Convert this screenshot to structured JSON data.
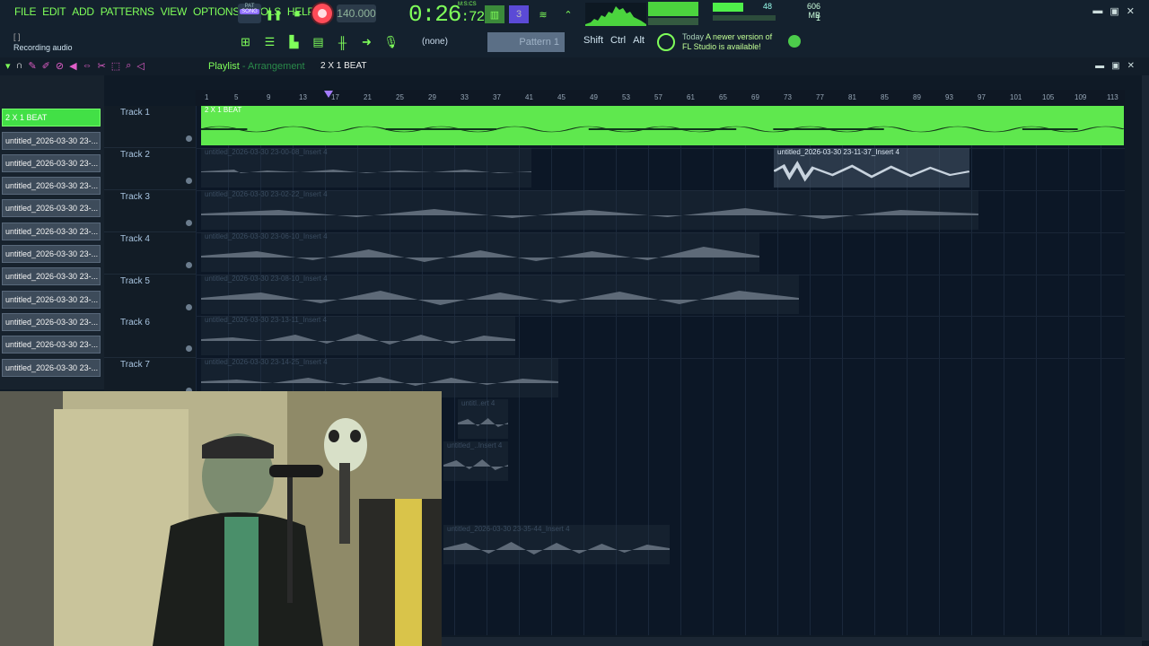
{
  "menu": [
    "FILE",
    "EDIT",
    "ADD",
    "PATTERNS",
    "VIEW",
    "OPTIONS",
    "TOOLS",
    "HELP"
  ],
  "transport": {
    "mode_pat": "PAT",
    "mode_song": "SONG",
    "tempo": "140.000",
    "time": "0:26",
    "time_small": ":72",
    "time_label": "M:S:CS",
    "cpu": "48",
    "memory": "606 MB",
    "voices": "1"
  },
  "status": {
    "indicator": "[ ]",
    "hint": "Recording audio"
  },
  "toolbar": {
    "channel_select": "(none)",
    "pattern_select": "Pattern 1",
    "shift": "Shift",
    "ctrl": "Ctrl",
    "alt": "Alt"
  },
  "news": {
    "when": "Today",
    "line1": "A newer version of",
    "line2": "FL Studio is available!"
  },
  "playlist": {
    "title": "Playlist",
    "sep": " - ",
    "view": "Arrangement",
    "pattern": "2 X 1 BEAT"
  },
  "picker": [
    "2 X 1 BEAT",
    "untitled_2026-03-30 23-...",
    "untitled_2026-03-30 23-...",
    "untitled_2026-03-30 23-...",
    "untitled_2026-03-30 23-...",
    "untitled_2026-03-30 23-...",
    "untitled_2026-03-30 23-...",
    "untitled_2026-03-30 23-...",
    "untitled_2026-03-30 23-...",
    "untitled_2026-03-30 23-...",
    "untitled_2026-03-30 23-...",
    "untitled_2026-03-30 23-..."
  ],
  "tracks": [
    "Track 1",
    "Track 2",
    "Track 3",
    "Track 4",
    "Track 5",
    "Track 6",
    "Track 7"
  ],
  "ruler": [
    "1",
    "5",
    "9",
    "13",
    "17",
    "21",
    "25",
    "29",
    "33",
    "37",
    "41",
    "45",
    "49",
    "53",
    "57",
    "61",
    "65",
    "69",
    "73",
    "77",
    "81",
    "85",
    "89",
    "93",
    "97",
    "101",
    "105",
    "109",
    "113"
  ],
  "clips": [
    {
      "label": "2 X 1 BEAT"
    },
    {
      "label": "untitled_2026-03-30 23-00-08_Insert 4"
    },
    {
      "label": "untitled_2026-03-30 23-11-37_Insert 4"
    },
    {
      "label": "untitled_2026-03-30 23-02-22_Insert 4"
    },
    {
      "label": "untitled_2026-03-30 23-06-10_Insert 4"
    },
    {
      "label": "untitled_2026-03-30 23-08-10_Insert 4"
    },
    {
      "label": "untitled_2026-03-30 23-13-11_Insert 4"
    },
    {
      "label": "untitled_2026-03-30 23-14-25_Insert 4"
    },
    {
      "label": "untitl..ert 4"
    },
    {
      "label": "untitled_..Insert 4"
    },
    {
      "label": "untitled_2026-03-30 23-35-44_Insert 4"
    }
  ],
  "colors": {
    "accent": "#7fff5a",
    "pattern_clip": "#5fe84e",
    "record": "#ff4b58"
  }
}
